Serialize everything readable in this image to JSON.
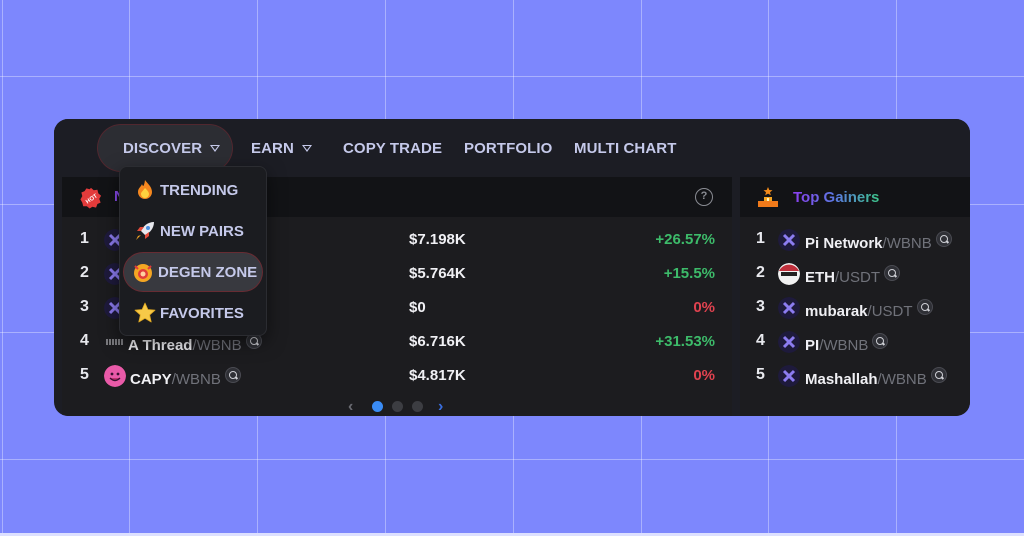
{
  "nav": {
    "items": [
      {
        "label": "DISCOVER",
        "has_caret": true,
        "active": true
      },
      {
        "label": "EARN",
        "has_caret": true
      },
      {
        "label": "COPY TRADE"
      },
      {
        "label": "PORTFOLIO"
      },
      {
        "label": "MULTI CHART"
      }
    ]
  },
  "dropdown": {
    "items": [
      {
        "label": "TRENDING",
        "icon": "fire-icon"
      },
      {
        "label": "NEW PAIRS",
        "icon": "rocket-icon"
      },
      {
        "label": "DEGEN ZONE",
        "icon": "degen-face-icon",
        "active": true
      },
      {
        "label": "FAVORITES",
        "icon": "star-icon"
      }
    ]
  },
  "main_table": {
    "badge": "HOT",
    "title_partial": "N",
    "help": "?",
    "rows": [
      {
        "rank": "1",
        "base": "",
        "quote": "",
        "price": "$7.198K",
        "change": "+26.57%",
        "trend": "up"
      },
      {
        "rank": "2",
        "base": "",
        "quote": "",
        "price": "$5.764K",
        "change": "+15.5%",
        "trend": "up"
      },
      {
        "rank": "3",
        "base": "",
        "quote": "",
        "price": "$0",
        "change": "0%",
        "trend": "flat"
      },
      {
        "rank": "4",
        "base": "A Thread",
        "quote": "/WBNB",
        "price": "$6.716K",
        "change": "+31.53%",
        "trend": "up"
      },
      {
        "rank": "5",
        "base": "CAPY",
        "quote": "/WBNB",
        "price": "$4.817K",
        "change": "0%",
        "trend": "flat"
      }
    ],
    "pager": {
      "pages": 3,
      "current": 1,
      "prev": "‹",
      "next": "›"
    }
  },
  "top_gainers": {
    "title": "Top Gainers",
    "rows": [
      {
        "rank": "1",
        "base": "Pi Network",
        "quote": "/WBNB"
      },
      {
        "rank": "2",
        "base": "ETH",
        "quote": "/USDT"
      },
      {
        "rank": "3",
        "base": "mubarak",
        "quote": "/USDT"
      },
      {
        "rank": "4",
        "base": "PI",
        "quote": "/WBNB"
      },
      {
        "rank": "5",
        "base": "Mashallah",
        "quote": "/WBNB"
      }
    ]
  },
  "colors": {
    "background": "#7d87fd",
    "panel": "#1c1d24",
    "up": "#3dbb6a",
    "down": "#e0424f",
    "accent_blue": "#3a8cf5",
    "title_purple": "#8b4bf0"
  }
}
